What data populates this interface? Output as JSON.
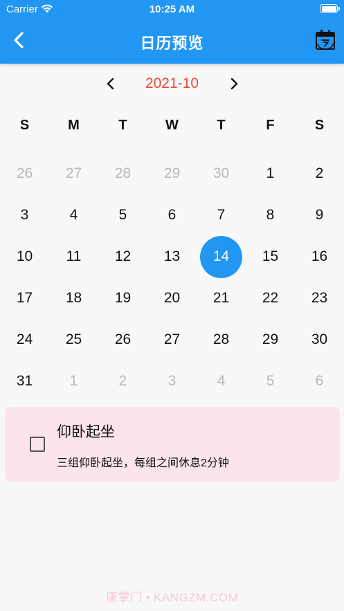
{
  "status_bar": {
    "carrier": "Carrier",
    "time": "10:25 AM"
  },
  "app_bar": {
    "title": "日历预览"
  },
  "calendar": {
    "month_label": "2021-10",
    "weekdays": [
      "S",
      "M",
      "T",
      "W",
      "T",
      "F",
      "S"
    ],
    "weeks": [
      [
        {
          "d": "26",
          "other": true
        },
        {
          "d": "27",
          "other": true
        },
        {
          "d": "28",
          "other": true
        },
        {
          "d": "29",
          "other": true
        },
        {
          "d": "30",
          "other": true
        },
        {
          "d": "1"
        },
        {
          "d": "2"
        }
      ],
      [
        {
          "d": "3"
        },
        {
          "d": "4"
        },
        {
          "d": "5"
        },
        {
          "d": "6"
        },
        {
          "d": "7"
        },
        {
          "d": "8"
        },
        {
          "d": "9"
        }
      ],
      [
        {
          "d": "10"
        },
        {
          "d": "11"
        },
        {
          "d": "12"
        },
        {
          "d": "13"
        },
        {
          "d": "14",
          "selected": true
        },
        {
          "d": "15"
        },
        {
          "d": "16"
        }
      ],
      [
        {
          "d": "17"
        },
        {
          "d": "18"
        },
        {
          "d": "19"
        },
        {
          "d": "20"
        },
        {
          "d": "21"
        },
        {
          "d": "22"
        },
        {
          "d": "23"
        }
      ],
      [
        {
          "d": "24"
        },
        {
          "d": "25"
        },
        {
          "d": "26"
        },
        {
          "d": "27"
        },
        {
          "d": "28"
        },
        {
          "d": "29"
        },
        {
          "d": "30"
        }
      ],
      [
        {
          "d": "31"
        },
        {
          "d": "1",
          "other": true
        },
        {
          "d": "2",
          "other": true
        },
        {
          "d": "3",
          "other": true
        },
        {
          "d": "4",
          "other": true
        },
        {
          "d": "5",
          "other": true
        },
        {
          "d": "6",
          "other": true
        }
      ]
    ]
  },
  "task": {
    "name": "仰卧起坐",
    "description": "三组仰卧起坐，每组之间休息2分钟",
    "checked": false
  },
  "watermark": "康掌门 • KANGZM.COM",
  "colors": {
    "primary": "#2196f3",
    "month_label": "#f0463d",
    "task_background": "#fbe4ec",
    "other_month_day": "#b8b8b8"
  },
  "icons": {
    "back": "chevron-left-icon",
    "today": "calendar-today-icon",
    "prev_month": "chevron-left-icon",
    "next_month": "chevron-right-icon"
  }
}
